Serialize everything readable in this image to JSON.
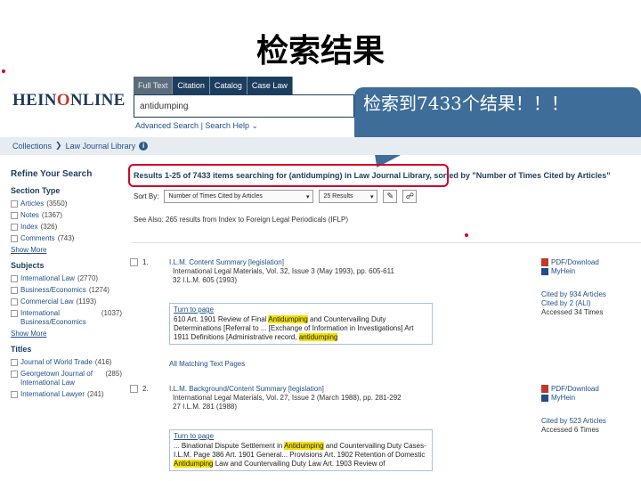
{
  "slide": {
    "title": "检索结果"
  },
  "logo": {
    "text_a": "H",
    "text_b": "EIN",
    "text_c": "O",
    "text_d": "NLINE"
  },
  "tabs": [
    "Full Text",
    "Citation",
    "Catalog",
    "Case Law"
  ],
  "search": {
    "value": "antidumping"
  },
  "search_links": {
    "advanced": "Advanced Search",
    "sep": "|",
    "help": "Search Help"
  },
  "callout": {
    "text": "检索到7433个结果！！！"
  },
  "breadcrumb": {
    "root": "Collections",
    "current": "Law Journal Library"
  },
  "sidebar": {
    "refine": "Refine Your Search",
    "section_type": {
      "heading": "Section Type",
      "items": [
        {
          "label": "Articles",
          "count": "(3550)"
        },
        {
          "label": "Notes",
          "count": "(1367)"
        },
        {
          "label": "Index",
          "count": "(326)"
        },
        {
          "label": "Comments",
          "count": "(743)"
        }
      ]
    },
    "show_more": "Show More",
    "subjects": {
      "heading": "Subjects",
      "items": [
        {
          "label": "International Law",
          "count": "(2770)"
        },
        {
          "label": "Business/Economics",
          "count": "(1274)"
        },
        {
          "label": "Commercial Law",
          "count": "(1193)"
        },
        {
          "label": "International Business/Economics",
          "count": "(1037)"
        }
      ]
    },
    "titles": {
      "heading": "Titles",
      "items": [
        {
          "label": "Journal of World Trade",
          "count": "(416)"
        },
        {
          "label": "Georgetown Journal of International Law",
          "count": "(285)"
        },
        {
          "label": "International Lawyer",
          "count": "(241)"
        }
      ]
    }
  },
  "results": {
    "header_boxed": "Results 1-25 of 7433 items searching for (antidumping) in Law Journal Library",
    "header_rest": ", sorted by \"Number of Times Cited by Articles\"",
    "sort_label": "Sort By:",
    "sort_value": "Number of Times Cited by Articles",
    "per_page": "25 Results",
    "see_also": "See Also: 265 results from Index to Foreign Legal Periodicals (IFLP)",
    "items": [
      {
        "num": "1.",
        "title": "I.L.M. Content Summary [legislation]",
        "cite_line1": "International Legal Materials, Vol. 32, Issue 3 (May 1993), pp. 605-611",
        "cite_line2": "32 I.L.M. 605 (1993)",
        "turn_to_page": "Turn to page",
        "snippet_a": "610 Art. 1901 Review of Final ",
        "snippet_hl1": "Antidumping",
        "snippet_b": " and Countervailing Duty Determinations [Referral to ... [Exchange of Information in Investigations] Art 1911 Definitions [Administrative record, ",
        "snippet_hl2": "antidumping",
        "all_matching": "All Matching Text Pages",
        "pdf": "PDF/Download",
        "myhein": "MyHein",
        "cited_articles": "Cited by 934 Articles",
        "cited_all": "Cited by 2 (ALI)",
        "accessed": "Accessed 34 Times"
      },
      {
        "num": "2.",
        "title": "I.L.M. Background/Content Summary [legislation]",
        "cite_line1": "International Legal Materials, Vol. 27, Issue 2 (March 1988), pp. 281-292",
        "cite_line2": "27 I.L.M. 281 (1988)",
        "turn_to_page": "Turn to page",
        "snippet_a": "... Binational Dispute Settlement in ",
        "snippet_hl1": "Antidumping",
        "snippet_b": " and Countervailing Duty Cases-I.L.M. Page 386 Art. 1901 General... Provisions Art. 1902 Retention of Domestic ",
        "snippet_hl2": "Antidumping",
        "snippet_c": " Law and Countervailing Duty Law Art. 1903 Review of",
        "pdf": "PDF/Download",
        "myhein": "MyHein",
        "cited_articles": "Cited by 523 Articles",
        "accessed": "Accessed 6 Times"
      }
    ]
  },
  "colors": {
    "brand_navy": "#1d3d5e",
    "callout_blue": "#3d6d98",
    "highlight_red": "#d1002c",
    "hit_yellow": "#f5e100"
  }
}
